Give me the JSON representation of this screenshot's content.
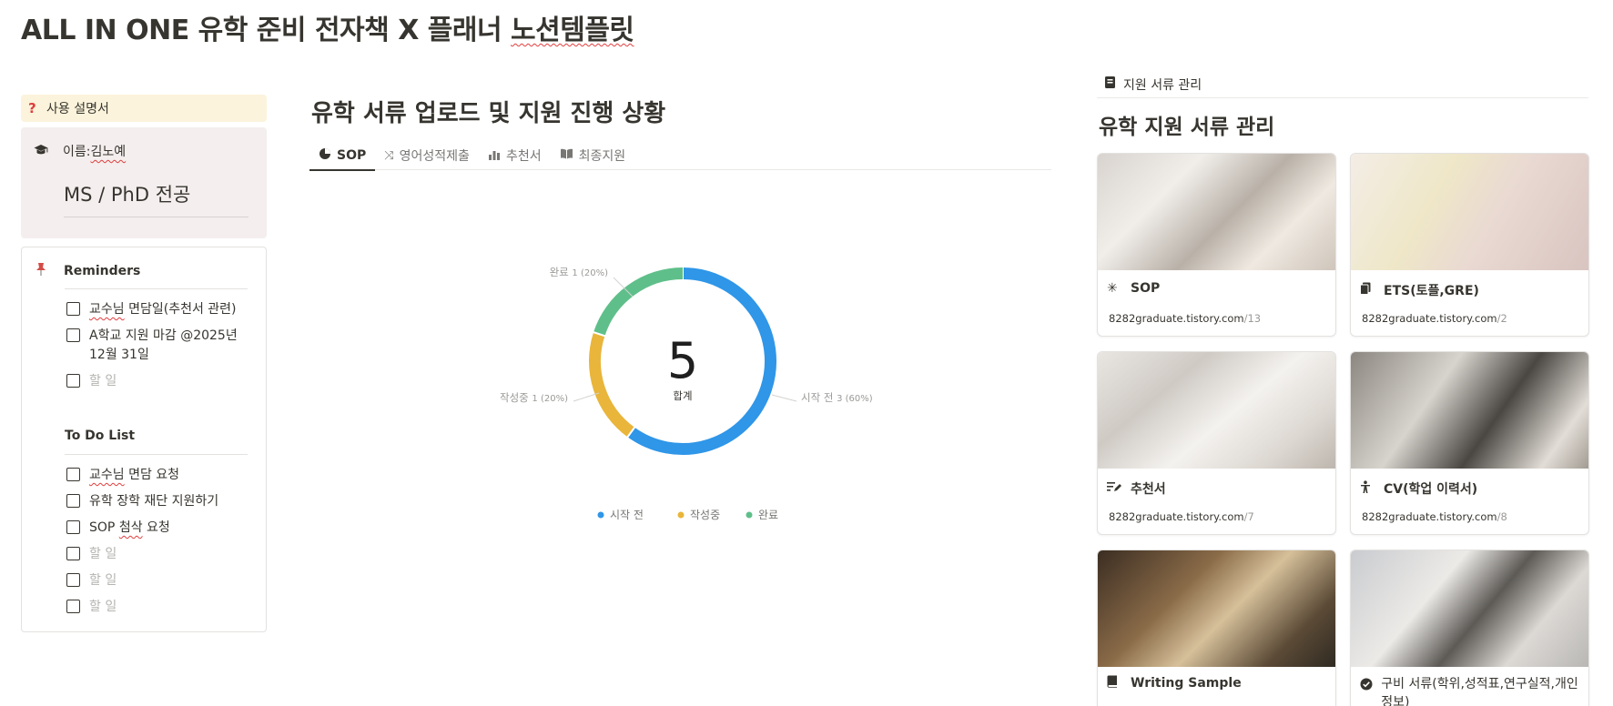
{
  "page": {
    "title_part1": "ALL IN ONE 유학 준비 전자책 X 플래너 ",
    "title_part2": "노션템플릿"
  },
  "left": {
    "manual_label": "사용 설명서",
    "name_label": "이름: ",
    "name_value": "김노예",
    "major": "MS / PhD 전공",
    "reminders_title": "Reminders",
    "reminders": [
      {
        "text_a": "교수님",
        "text_b": " 면담일(추천서 관련)",
        "checked": false
      },
      {
        "text_a": "A학교 지원 마감 @2025년 12월 31일",
        "text_b": "",
        "checked": false
      },
      {
        "text_a": "할 일",
        "text_b": "",
        "checked": false,
        "placeholder": true
      }
    ],
    "todo_title": "To Do List",
    "todos": [
      {
        "text_a": "교수님",
        "text_b": " 면담 요청"
      },
      {
        "text_a": "유학 장학 재단 지원하기",
        "text_b": ""
      },
      {
        "text_a": "SOP ",
        "text_b": "첨삭",
        "text_c": " 요청"
      },
      {
        "text_a": "할 일",
        "placeholder": true
      },
      {
        "text_a": "할 일",
        "placeholder": true
      },
      {
        "text_a": "할 일",
        "placeholder": true
      }
    ]
  },
  "middle": {
    "title": "유학 서류 업로드 및 지원 진행 상황",
    "tabs": [
      {
        "label": "SOP",
        "icon": "pie-chart-icon",
        "active": true
      },
      {
        "label": "영어성적제출",
        "icon": "shuffle-icon",
        "active": false
      },
      {
        "label": "추천서",
        "icon": "people-chart-icon",
        "active": false
      },
      {
        "label": "최종지원",
        "icon": "book-open-icon",
        "active": false
      }
    ]
  },
  "chart_data": {
    "type": "pie",
    "donut": true,
    "total": 5,
    "total_label": "합계",
    "slices": [
      {
        "name": "시작 전",
        "value": 3,
        "percent": "60%",
        "color": "#2f96e8"
      },
      {
        "name": "작성중",
        "value": 1,
        "percent": "20%",
        "color": "#e9b53a"
      },
      {
        "name": "완료",
        "value": 1,
        "percent": "20%",
        "color": "#5fbf8a"
      }
    ],
    "legend": "bottom"
  },
  "right": {
    "breadcrumb": "지원 서류 관리",
    "title": "유학 지원 서류 관리",
    "cards": [
      {
        "title": "SOP",
        "icon": "sparkle-icon",
        "url_host": "8282graduate.tistory.com",
        "url_path": "/13"
      },
      {
        "title": "ETS(토플,GRE)",
        "icon": "documents-icon",
        "url_host": "8282graduate.tistory.com",
        "url_path": "/2"
      },
      {
        "title": "추천서",
        "icon": "edit-lines-icon",
        "url_host": "8282graduate.tistory.com",
        "url_path": "/7"
      },
      {
        "title": "CV(학업 이력서)",
        "icon": "person-icon",
        "url_host": "8282graduate.tistory.com",
        "url_path": "/8"
      },
      {
        "title": "Writing Sample",
        "icon": "book-icon",
        "url_host": "",
        "url_path": ""
      },
      {
        "title": "구비 서류(학위,성적표,연구실적,개인정보)",
        "icon": "check-circle-icon",
        "url_host": "",
        "url_path": ""
      }
    ]
  }
}
